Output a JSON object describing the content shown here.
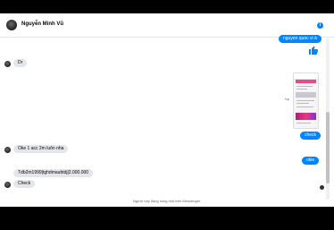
{
  "header": {
    "name": "Nguyễn Minh Vũ",
    "info_glyph": "i"
  },
  "messages": [
    {
      "side": "out",
      "text": "nguyen quoc vi á"
    },
    {
      "side": "in",
      "text": "Dr"
    },
    {
      "side": "out",
      "text": "check"
    },
    {
      "side": "in",
      "text": "Oke 1 acc 2m luôn nha"
    },
    {
      "side": "out",
      "text": "okie"
    },
    {
      "side": "in",
      "text": "Tdb2m1999|tghdmaubtdj|2.000.000"
    },
    {
      "side": "in",
      "text": "Check"
    }
  ],
  "icons": {
    "thumbs_up": "thumbs-up-icon",
    "share": "share-icon",
    "info": "info-icon"
  },
  "colors": {
    "accent": "#0084ff",
    "incoming_bubble": "#e4e6eb"
  },
  "footer": {
    "text": "Người này đang sống một trên Messenger."
  }
}
